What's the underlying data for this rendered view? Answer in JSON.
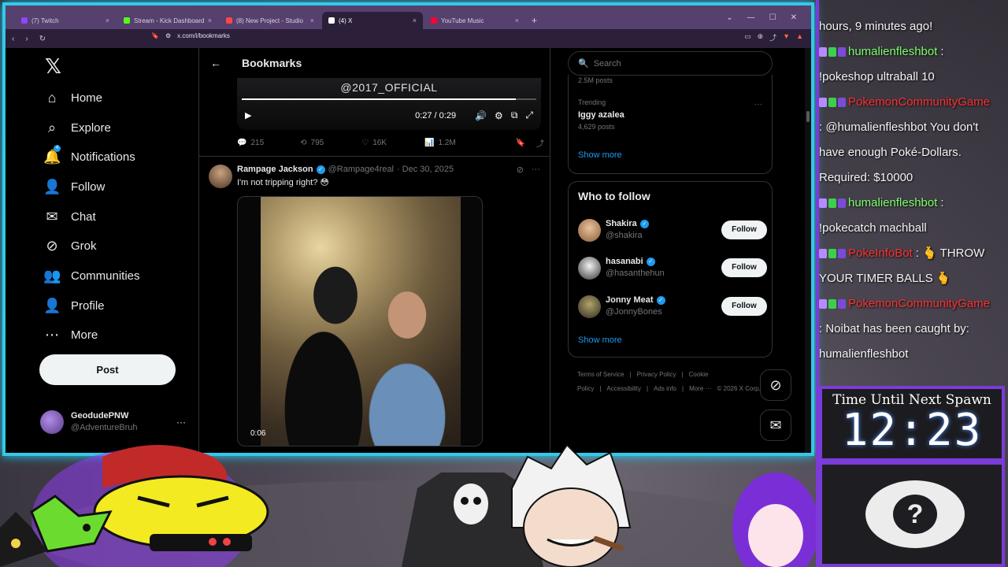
{
  "browser": {
    "tabs": [
      {
        "label": "(7) Twitch",
        "color": "#9146ff",
        "active": false
      },
      {
        "label": "Stream - Kick Dashboard",
        "color": "#53fc18",
        "active": false
      },
      {
        "label": "(8) New Project - Studio",
        "color": "#ff4545",
        "active": false
      },
      {
        "label": "(4) X",
        "color": "#ffffff",
        "active": true
      },
      {
        "label": "YouTube Music",
        "color": "#ff0033",
        "active": false
      }
    ],
    "url": "x.com/i/bookmarks"
  },
  "nav": {
    "items": [
      {
        "label": "Home",
        "icon": "home-icon"
      },
      {
        "label": "Explore",
        "icon": "search-icon"
      },
      {
        "label": "Notifications",
        "icon": "bell-icon",
        "badge": "4"
      },
      {
        "label": "Follow",
        "icon": "add-person-icon"
      },
      {
        "label": "Chat",
        "icon": "mail-icon"
      },
      {
        "label": "Grok",
        "icon": "grok-icon"
      },
      {
        "label": "Communities",
        "icon": "people-icon"
      },
      {
        "label": "Profile",
        "icon": "person-icon"
      },
      {
        "label": "More",
        "icon": "more-circle-icon"
      }
    ],
    "post_label": "Post",
    "account_name": "GeodudePNW",
    "account_handle": "@AdventureBruh"
  },
  "main": {
    "title": "Bookmarks",
    "video1": {
      "watermark": "@2017_OFFICIAL",
      "time": "0:27 / 0:29",
      "progress": 0.93
    },
    "actions1": {
      "replies": "215",
      "reposts": "795",
      "likes": "16K",
      "views": "1.2M"
    },
    "tweet2": {
      "name": "Rampage Jackson",
      "handle": "@Rampage4real",
      "date": "· Dec 30, 2025",
      "text": "I'm not tripping right? 😳",
      "video_time": "0:06"
    }
  },
  "right": {
    "search_placeholder": "Search",
    "posts_count_top": "2.5M posts",
    "trending_label": "Trending",
    "trending_name": "Iggy azalea",
    "trending_count": "4,629 posts",
    "show_more": "Show more",
    "who_to_follow": "Who to follow",
    "follow_label": "Follow",
    "suggestions": [
      {
        "name": "Shakira",
        "handle": "@shakira"
      },
      {
        "name": "hasanabi",
        "handle": "@hasanthehun"
      },
      {
        "name": "Jonny Meat",
        "handle": "@JonnyBones"
      }
    ],
    "footer": [
      "Terms of Service",
      "|",
      "Privacy Policy",
      "|",
      "Cookie Policy",
      "|",
      "Accessibility",
      "|",
      "Ads info",
      "|",
      "More ···",
      "© 2026 X Corp."
    ]
  },
  "chat": {
    "lines": [
      {
        "text": "hours, 9 minutes ago!"
      },
      {
        "user": "humalienfleshbot",
        "color": "green",
        "msg": ":"
      },
      {
        "text": "!pokeshop ultraball 10"
      },
      {
        "user": "PokemonCommunityGame",
        "color": "red",
        "msg": ""
      },
      {
        "text": ": @humalienfleshbot You don't"
      },
      {
        "text": "have enough Poké-Dollars."
      },
      {
        "text": "Required: $10000"
      },
      {
        "user": "humalienfleshbot",
        "color": "green",
        "msg": ":"
      },
      {
        "text": "!pokecatch machball"
      },
      {
        "user": "PokeInfoBot",
        "color": "red",
        "msg": ": 🫰 THROW"
      },
      {
        "text": "YOUR TIMER BALLS 🫰"
      },
      {
        "user": "PokemonCommunityGame",
        "color": "red",
        "msg": ""
      },
      {
        "text": ": Noibat has been caught by:"
      },
      {
        "text": "humalienfleshbot"
      }
    ]
  },
  "timer": {
    "label": "Time Until Next Spawn",
    "value": "12:23"
  }
}
